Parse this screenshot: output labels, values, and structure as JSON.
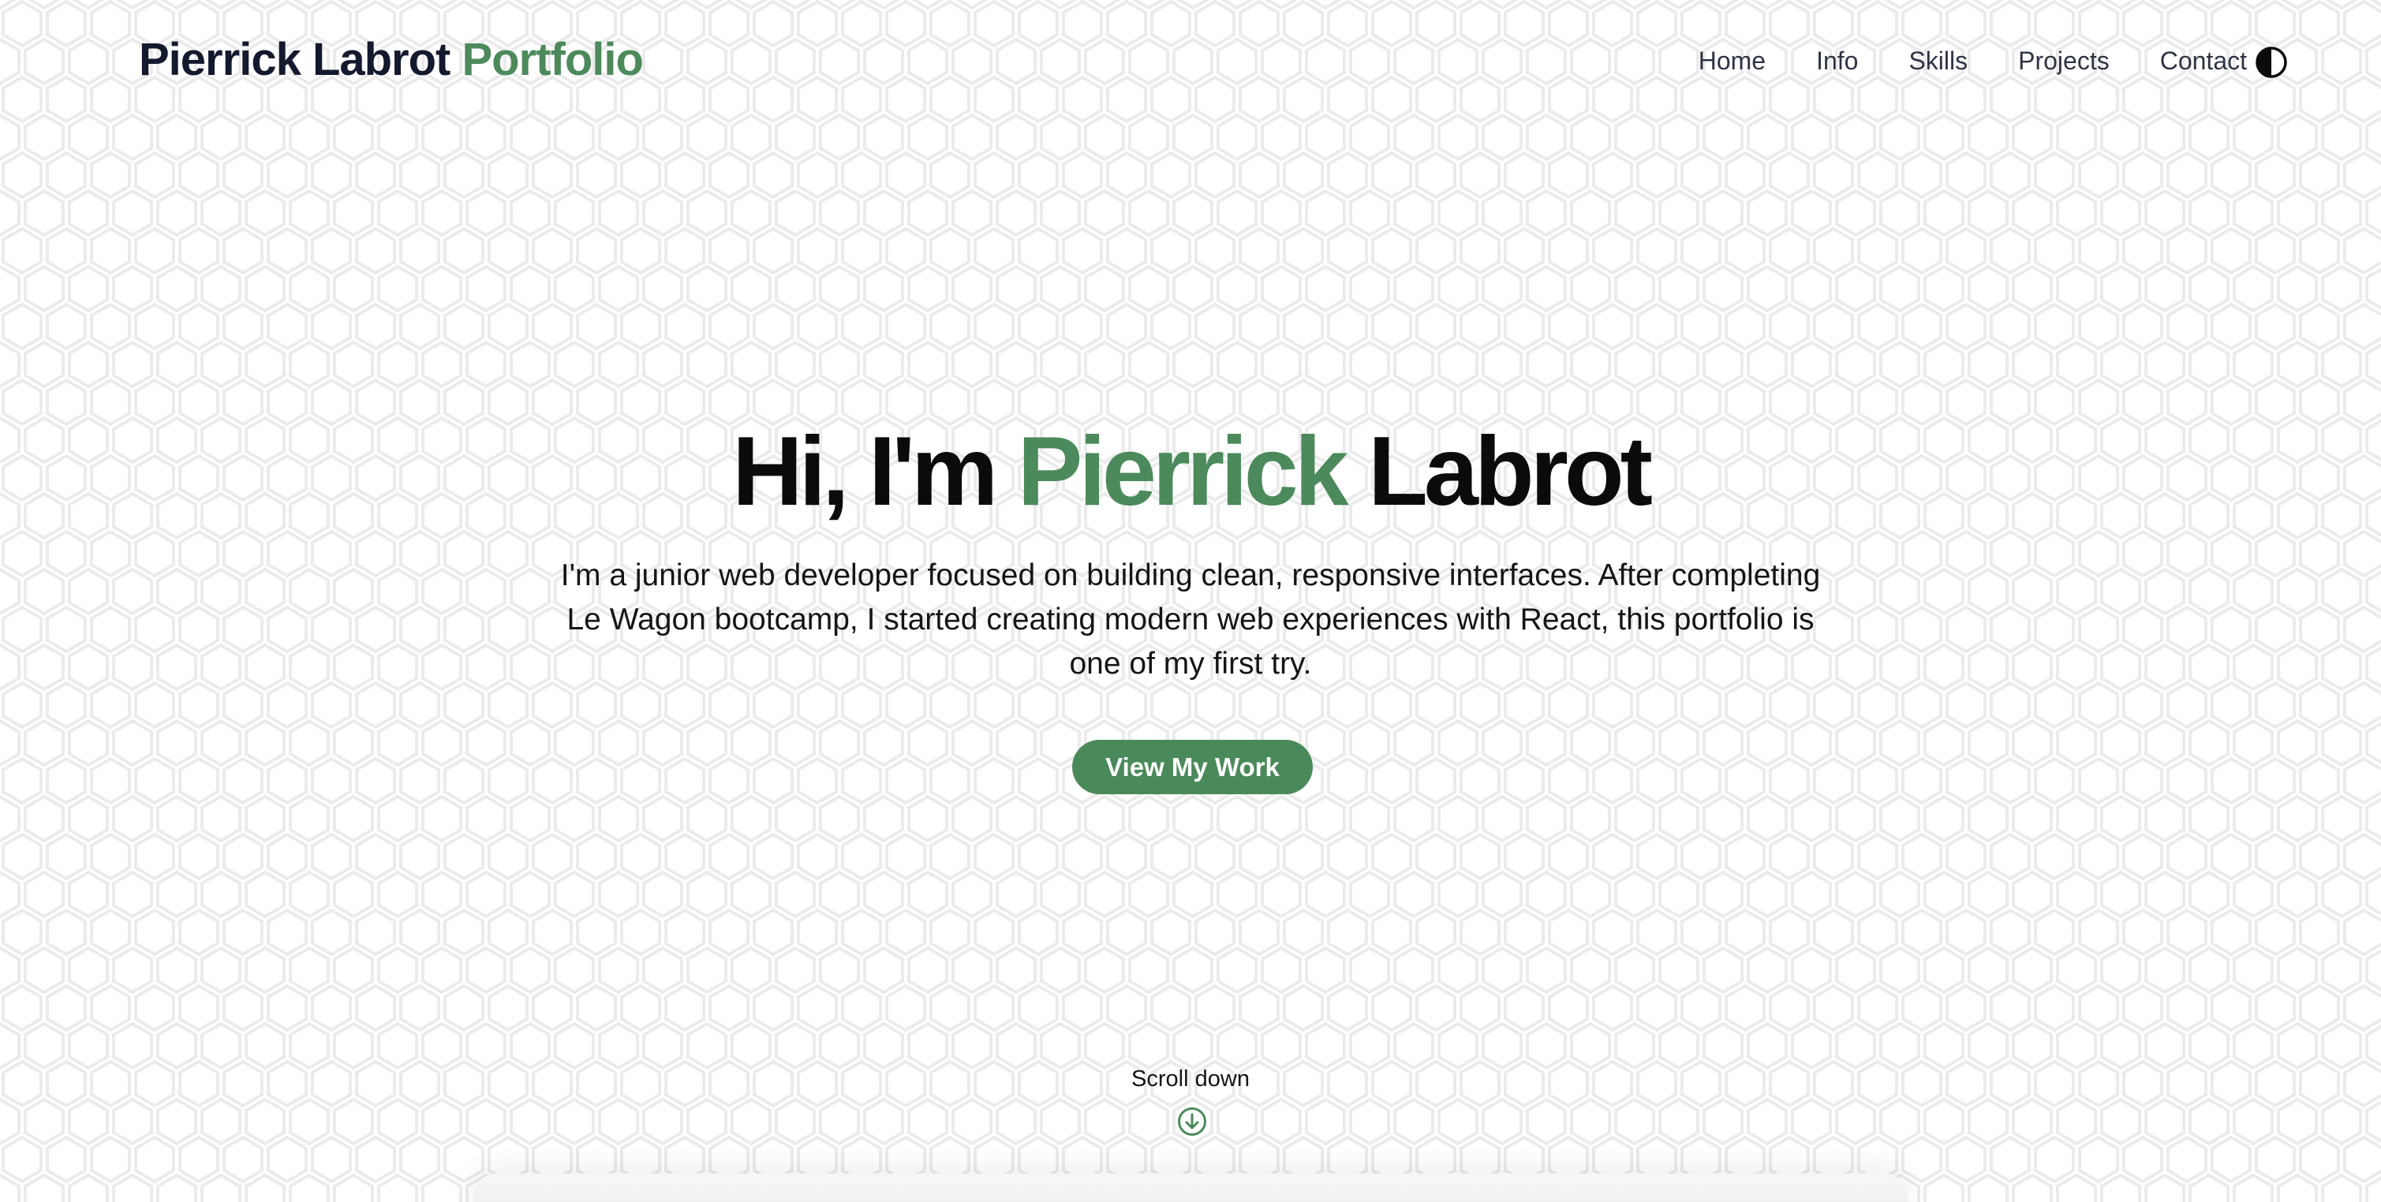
{
  "brand": {
    "name": "Pierrick Labrot",
    "accent": "Portfolio"
  },
  "nav": {
    "items": [
      {
        "label": "Home"
      },
      {
        "label": "Info"
      },
      {
        "label": "Skills"
      },
      {
        "label": "Projects"
      },
      {
        "label": "Contact"
      }
    ],
    "theme_toggle_icon": "contrast-half-circle-icon"
  },
  "hero": {
    "greeting": "Hi, I'm",
    "first_name": "Pierrick",
    "last_name": "Labrot",
    "description": "I'm a junior web developer focused on building clean, responsive interfaces. After completing Le Wagon bootcamp, I started creating modern web experiences with React, this portfolio is one of my first try.",
    "cta_label": "View My Work",
    "scroll_label": "Scroll down",
    "scroll_icon": "arrow-down-circle-icon"
  },
  "colors": {
    "accent": "#4c8a5b",
    "brand_text": "#131a2e",
    "button_bg": "#4a8a5a",
    "pattern_stroke": "#ebebeb",
    "background": "#ffffff"
  }
}
